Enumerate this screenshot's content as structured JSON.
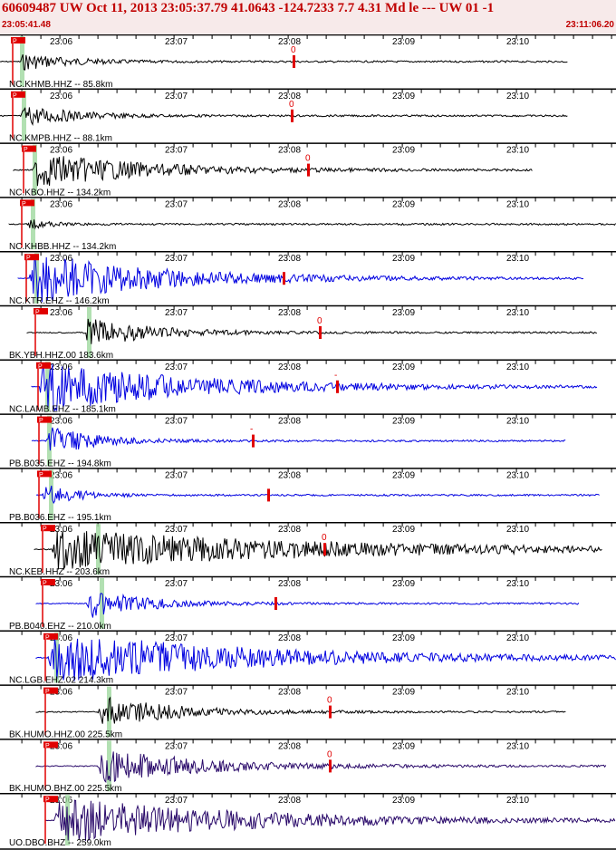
{
  "header": {
    "title": "60609487 UW Oct 11, 2013 23:05:37.79   41.0643 -124.7233  7.7 4.31 Md le --- UW 01  -1",
    "start_time": "23:05:41.48",
    "end_time": "23:11:06.20"
  },
  "time_ticks": [
    "23:06",
    "23:07",
    "23:08",
    "23:09",
    "23:10"
  ],
  "pick_label": "P",
  "colors": {
    "black": "#000000",
    "blue": "#0000e0",
    "purple": "#2a0a6a",
    "pick": "#e00000",
    "window": "#9fd89f",
    "header_text": "#c00000",
    "header_bg": "#f7eaea"
  },
  "traces": [
    {
      "label": "NC.KHMB.HHZ -- 85.8km",
      "color": "black",
      "s_label": "0"
    },
    {
      "label": "NC.KMPB.HHZ -- 88.1km",
      "color": "black",
      "s_label": "0"
    },
    {
      "label": "NC.KBO.HHZ -- 134.2km",
      "color": "black",
      "s_label": "0"
    },
    {
      "label": "NC.KHBB.HHZ -- 134.2km",
      "color": "black",
      "s_label": ""
    },
    {
      "label": "NC.KTR.EHZ -- 146.2km",
      "color": "blue",
      "s_label": ""
    },
    {
      "label": "BK.YBH.HHZ.00 183.6km",
      "color": "black",
      "s_label": "0"
    },
    {
      "label": "NC.LAMB.EHZ -- 185.1km",
      "color": "blue",
      "s_label": "-"
    },
    {
      "label": "PB.B035.EHZ -- 194.8km",
      "color": "blue",
      "s_label": "-"
    },
    {
      "label": "PB.B036.EHZ -- 195.1km",
      "color": "blue",
      "s_label": ""
    },
    {
      "label": "NC.KEB.HHZ -- 203.6km",
      "color": "black",
      "s_label": "0"
    },
    {
      "label": "PB.B040.EHZ -- 210.0km",
      "color": "blue",
      "s_label": ""
    },
    {
      "label": "NC.LGB.EHZ.02 214.3km",
      "color": "blue",
      "s_label": ""
    },
    {
      "label": "BK.HUMO.HHZ.00 225.5km",
      "color": "black",
      "s_label": "0"
    },
    {
      "label": "BK.HUMO.BHZ.00 225.5km",
      "color": "purple",
      "s_label": "0"
    },
    {
      "label": "UO.DBO.BHZ -- 259.0km",
      "color": "purple",
      "s_label": ""
    }
  ]
}
